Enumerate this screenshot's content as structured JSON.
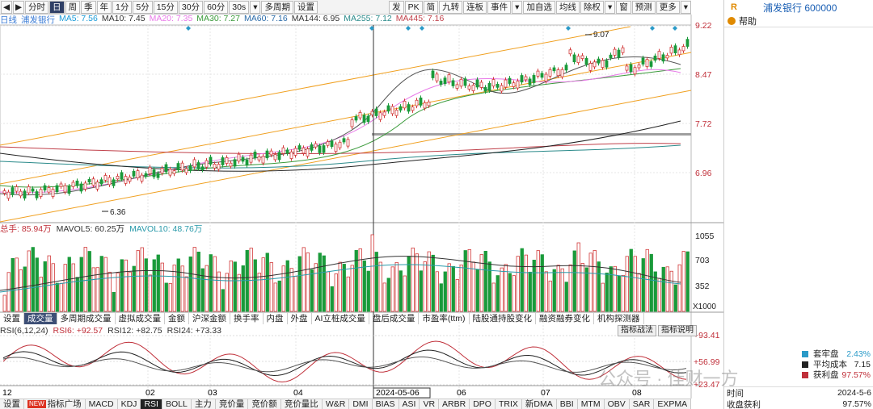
{
  "toolbar": {
    "left_arrow": "◀",
    "right_arrow": "▶",
    "periods": [
      "分时",
      "日",
      "周",
      "季",
      "年",
      "1分",
      "5分",
      "15分",
      "30分",
      "60分",
      "30s",
      "▾",
      "多周期",
      "设置"
    ],
    "active_period": "日",
    "right_buttons": [
      "发",
      "PK",
      "简",
      "九转",
      "连板",
      "事件",
      "▾",
      "加自选",
      "均线",
      "除权",
      "▾",
      "窗",
      "预测",
      "更多",
      "▾"
    ]
  },
  "window_icons": [
    "⊗",
    "↺",
    "⊗",
    "⊕",
    "⊖",
    "▾"
  ],
  "ma_legend": {
    "label": "日线",
    "items": [
      {
        "text": "浦发银行",
        "color": "#3a7bd5"
      },
      {
        "text": "MA5: 7.56",
        "color": "#1a9bd8"
      },
      {
        "text": "MA10: 7.45",
        "color": "#333333"
      },
      {
        "text": "MA20: 7.35",
        "color": "#e879e8"
      },
      {
        "text": "MA30: 7.27",
        "color": "#3a9a3a"
      },
      {
        "text": "MA60: 7.16",
        "color": "#2a6aa8"
      },
      {
        "text": "MA144: 6.95",
        "color": "#333333"
      },
      {
        "text": "MA255: 7.12",
        "color": "#2a8a8a"
      },
      {
        "text": "MA445: 7.16",
        "color": "#c0404a"
      }
    ]
  },
  "price_axis": [
    "9.22",
    "8.47",
    "7.72",
    "6.96"
  ],
  "price_annotations": {
    "high": "9.07",
    "low": "6.36"
  },
  "volume_legend": {
    "items": [
      {
        "text": "总手: 85.94万",
        "color": "#c0303a"
      },
      {
        "text": "MAVOL5: 60.25万",
        "color": "#333333"
      },
      {
        "text": "MAVOL10: 48.76万",
        "color": "#2a9aaa"
      }
    ],
    "axis": [
      "1055",
      "703",
      "352"
    ],
    "unit": "X1000"
  },
  "indicator_tabs": [
    "设置",
    "成交量",
    "多周期成交量",
    "虚拟成交量",
    "金额",
    "沪深金额",
    "换手率",
    "内盘",
    "外盘",
    "AI立桩成交量",
    "盘后成交量",
    "市盈率(ttm)",
    "陆股通持股变化",
    "融资融券变化",
    "机构探测器"
  ],
  "active_indicator_tab": "成交量",
  "rsi": {
    "legend": [
      {
        "text": "RSI(6,12,24)",
        "color": "#333333"
      },
      {
        "text": "RSI6: +92.57",
        "color": "#c0303a"
      },
      {
        "text": "RSI12: +82.75",
        "color": "#333333"
      },
      {
        "text": "RSI24: +73.33",
        "color": "#333333"
      }
    ],
    "buttons": [
      "指标战法",
      "指标说明"
    ],
    "axis": [
      "+93.41",
      "+56.99",
      "+23.47"
    ]
  },
  "dates": {
    "m12": "12",
    "m02": "02",
    "m03": "03",
    "m04": "04",
    "cursor": "2024-05-06",
    "m06": "06",
    "m07": "07",
    "m08": "08"
  },
  "bottom_tabs": [
    "设置",
    "指标广场",
    "MACD",
    "KDJ",
    "RSI",
    "BOLL",
    "主力",
    "竞价量",
    "竞价额",
    "竞价量比",
    "W&R",
    "DMI",
    "BIAS",
    "ASI",
    "VR",
    "ARBR",
    "DPO",
    "TRIX",
    "新DMA",
    "BBI",
    "MTM",
    "OBV",
    "SAR",
    "EXPMA"
  ],
  "new_badge": "NEW",
  "active_bottom_tab": "RSI",
  "right_panel": {
    "rating": "R",
    "stock_name": "浦发银行 600000",
    "help": "帮助",
    "stats": [
      {
        "label": "套牢盘",
        "value": "2.43%",
        "color": "#2a9ac8",
        "value_color": "#2a9ac8"
      },
      {
        "label": "平均成本",
        "value": "7.15",
        "color": "#222222",
        "value_color": "#222222"
      },
      {
        "label": "获利盘",
        "value": "97.57%",
        "color": "#c0303a",
        "value_color": "#c0303a"
      }
    ],
    "footer": [
      {
        "label": "时间",
        "value": "2024-5-6"
      },
      {
        "label": "收盘获利",
        "value": "97.57%"
      }
    ]
  },
  "watermark": "公众号 · 佳财一方"
}
